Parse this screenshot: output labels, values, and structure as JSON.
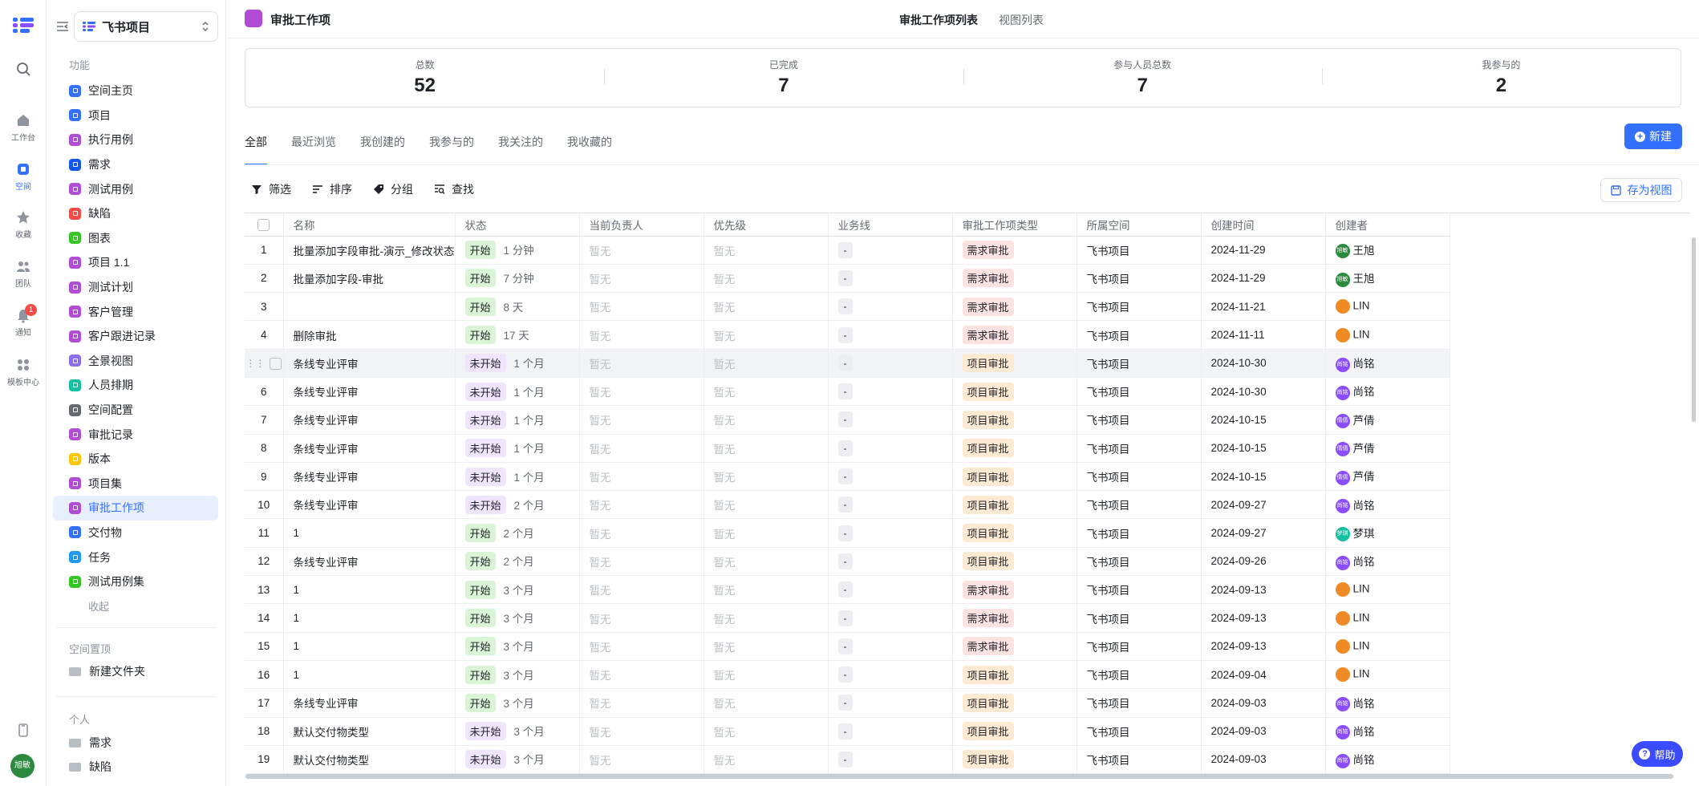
{
  "rail": {
    "items": [
      {
        "label": "",
        "icon": "search-icon"
      },
      {
        "label": "工作台",
        "icon": "home-icon"
      },
      {
        "label": "空间",
        "icon": "space-icon"
      },
      {
        "label": "收藏",
        "icon": "star-icon"
      },
      {
        "label": "团队",
        "icon": "team-icon"
      },
      {
        "label": "通知",
        "icon": "bell-icon"
      },
      {
        "label": "模板中心",
        "icon": "template-icon"
      }
    ],
    "notify_badge": "1",
    "avatar_text": "旭敏"
  },
  "sidebar": {
    "project": "飞书项目",
    "section_title": "功能",
    "items": [
      {
        "label": "空间主页",
        "color": "#3370ff"
      },
      {
        "label": "项目",
        "color": "#3370ff"
      },
      {
        "label": "执行用例",
        "color": "#b24bd6"
      },
      {
        "label": "需求",
        "color": "#1456f0"
      },
      {
        "label": "测试用例",
        "color": "#b24bd6"
      },
      {
        "label": "缺陷",
        "color": "#f54a45"
      },
      {
        "label": "图表",
        "color": "#34c724"
      },
      {
        "label": "项目 1.1",
        "color": "#b24bd6"
      },
      {
        "label": "测试计划",
        "color": "#b24bd6"
      },
      {
        "label": "客户管理",
        "color": "#b24bd6"
      },
      {
        "label": "客户跟进记录",
        "color": "#b24bd6"
      },
      {
        "label": "全景视图",
        "color": "#8a6df0"
      },
      {
        "label": "人员排期",
        "color": "#14c0a0"
      },
      {
        "label": "空间配置",
        "color": "#646a73"
      },
      {
        "label": "审批记录",
        "color": "#b24bd6"
      },
      {
        "label": "版本",
        "color": "#ffc60a"
      },
      {
        "label": "项目集",
        "color": "#b24bd6"
      },
      {
        "label": "审批工作项",
        "color": "#b24bd6"
      },
      {
        "label": "交付物",
        "color": "#3370ff"
      },
      {
        "label": "任务",
        "color": "#1e9bf0"
      },
      {
        "label": "测试用例集",
        "color": "#34c724"
      }
    ],
    "collapse_label": "收起",
    "pinned_title": "空间置顶",
    "pinned_items": [
      "新建文件夹"
    ],
    "personal_title": "个人",
    "personal_items": [
      "需求",
      "缺陷"
    ]
  },
  "header": {
    "title": "审批工作项",
    "tabs": [
      "审批工作项列表",
      "视图列表"
    ]
  },
  "stats": [
    {
      "label": "总数",
      "value": "52"
    },
    {
      "label": "已完成",
      "value": "7"
    },
    {
      "label": "参与人员总数",
      "value": "7"
    },
    {
      "label": "我参与的",
      "value": "2"
    }
  ],
  "filter_tabs": [
    "全部",
    "最近浏览",
    "我创建的",
    "我参与的",
    "我关注的",
    "我收藏的"
  ],
  "new_button": "新建",
  "toolbar": {
    "filter": "筛选",
    "sort": "排序",
    "group": "分组",
    "find": "查找",
    "save_view": "存为视图"
  },
  "table": {
    "columns": [
      "名称",
      "状态",
      "当前负责人",
      "优先级",
      "业务线",
      "审批工作项类型",
      "所属空间",
      "创建时间",
      "创建者"
    ],
    "none_text": "暂无",
    "dash_text": "-",
    "rows": [
      {
        "idx": "1",
        "name": "批量添加字段审批-演示_修改状态",
        "status": "开始",
        "dur": "1 分钟",
        "type": "需求审批",
        "space": "飞书项目",
        "date": "2024-11-29",
        "creator": "王旭",
        "av": "#2b8a3e",
        "av_text": "旭敏"
      },
      {
        "idx": "2",
        "name": "批量添加字段-审批",
        "status": "开始",
        "dur": "7 分钟",
        "type": "需求审批",
        "space": "飞书项目",
        "date": "2024-11-29",
        "creator": "王旭",
        "av": "#2b8a3e",
        "av_text": "旭敏"
      },
      {
        "idx": "3",
        "name": "",
        "status": "开始",
        "dur": "8 天",
        "type": "需求审批",
        "space": "飞书项目",
        "date": "2024-11-21",
        "creator": "LIN",
        "av": "#f08a24",
        "av_text": ""
      },
      {
        "idx": "4",
        "name": "删除审批",
        "status": "开始",
        "dur": "17 天",
        "type": "需求审批",
        "space": "飞书项目",
        "date": "2024-11-11",
        "creator": "LIN",
        "av": "#f08a24",
        "av_text": ""
      },
      {
        "idx": "",
        "name": "条线专业评审",
        "status": "未开始",
        "dur": "1 个月",
        "type": "项目审批",
        "space": "飞书项目",
        "date": "2024-10-30",
        "creator": "尚铭",
        "av": "#8a4dff",
        "av_text": "尚铭"
      },
      {
        "idx": "6",
        "name": "条线专业评审",
        "status": "未开始",
        "dur": "1 个月",
        "type": "项目审批",
        "space": "飞书项目",
        "date": "2024-10-30",
        "creator": "尚铭",
        "av": "#8a4dff",
        "av_text": "尚铭"
      },
      {
        "idx": "7",
        "name": "条线专业评审",
        "status": "未开始",
        "dur": "1 个月",
        "type": "项目审批",
        "space": "飞书项目",
        "date": "2024-10-15",
        "creator": "芦倩",
        "av": "#8a4dff",
        "av_text": "倩倩"
      },
      {
        "idx": "8",
        "name": "条线专业评审",
        "status": "未开始",
        "dur": "1 个月",
        "type": "项目审批",
        "space": "飞书项目",
        "date": "2024-10-15",
        "creator": "芦倩",
        "av": "#8a4dff",
        "av_text": "倩倩"
      },
      {
        "idx": "9",
        "name": "条线专业评审",
        "status": "未开始",
        "dur": "1 个月",
        "type": "项目审批",
        "space": "飞书项目",
        "date": "2024-10-15",
        "creator": "芦倩",
        "av": "#8a4dff",
        "av_text": "倩倩"
      },
      {
        "idx": "10",
        "name": "条线专业评审",
        "status": "未开始",
        "dur": "2 个月",
        "type": "项目审批",
        "space": "飞书项目",
        "date": "2024-09-27",
        "creator": "尚铭",
        "av": "#8a4dff",
        "av_text": "尚铭"
      },
      {
        "idx": "11",
        "name": "1",
        "status": "开始",
        "dur": "2 个月",
        "type": "项目审批",
        "space": "飞书项目",
        "date": "2024-09-27",
        "creator": "梦琪",
        "av": "#14c0a0",
        "av_text": "梦琪"
      },
      {
        "idx": "12",
        "name": "条线专业评审",
        "status": "开始",
        "dur": "2 个月",
        "type": "项目审批",
        "space": "飞书项目",
        "date": "2024-09-26",
        "creator": "尚铭",
        "av": "#8a4dff",
        "av_text": "尚铭"
      },
      {
        "idx": "13",
        "name": "1",
        "status": "开始",
        "dur": "3 个月",
        "type": "需求审批",
        "space": "飞书项目",
        "date": "2024-09-13",
        "creator": "LIN",
        "av": "#f08a24",
        "av_text": ""
      },
      {
        "idx": "14",
        "name": "1",
        "status": "开始",
        "dur": "3 个月",
        "type": "需求审批",
        "space": "飞书项目",
        "date": "2024-09-13",
        "creator": "LIN",
        "av": "#f08a24",
        "av_text": ""
      },
      {
        "idx": "15",
        "name": "1",
        "status": "开始",
        "dur": "3 个月",
        "type": "需求审批",
        "space": "飞书项目",
        "date": "2024-09-13",
        "creator": "LIN",
        "av": "#f08a24",
        "av_text": ""
      },
      {
        "idx": "16",
        "name": "1",
        "status": "开始",
        "dur": "3 个月",
        "type": "项目审批",
        "space": "飞书项目",
        "date": "2024-09-04",
        "creator": "LIN",
        "av": "#f08a24",
        "av_text": ""
      },
      {
        "idx": "17",
        "name": "条线专业评审",
        "status": "开始",
        "dur": "3 个月",
        "type": "项目审批",
        "space": "飞书项目",
        "date": "2024-09-03",
        "creator": "尚铭",
        "av": "#8a4dff",
        "av_text": "尚铭"
      },
      {
        "idx": "18",
        "name": "默认交付物类型",
        "status": "未开始",
        "dur": "3 个月",
        "type": "项目审批",
        "space": "飞书项目",
        "date": "2024-09-03",
        "creator": "尚铭",
        "av": "#8a4dff",
        "av_text": "尚铭"
      },
      {
        "idx": "19",
        "name": "默认交付物类型",
        "status": "未开始",
        "dur": "3 个月",
        "type": "项目审批",
        "space": "飞书项目",
        "date": "2024-09-03",
        "creator": "尚铭",
        "av": "#8a4dff",
        "av_text": "尚铭"
      }
    ]
  },
  "help_label": "帮助"
}
